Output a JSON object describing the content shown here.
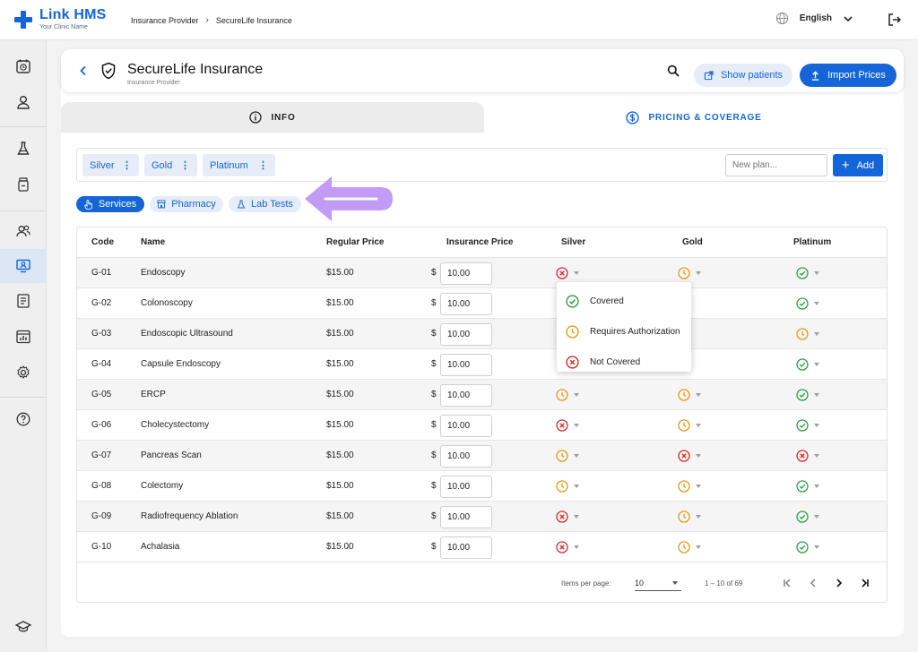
{
  "app": {
    "name": "Link HMS",
    "subtitle": "Your Clinic Name",
    "brand_color": "#1565d8"
  },
  "breadcrumb": [
    "Insurance Provider",
    "SecureLife Insurance"
  ],
  "topbar": {
    "language": "English"
  },
  "header": {
    "title": "SecureLife Insurance",
    "subtitle": "Insurance Provider",
    "show_patients": "Show patients",
    "import_prices": "Import Prices"
  },
  "tabs": [
    {
      "label": "INFO",
      "active": false
    },
    {
      "label": "PRICING & COVERAGE",
      "active": true
    }
  ],
  "plans": [
    {
      "label": "Silver"
    },
    {
      "label": "Gold"
    },
    {
      "label": "Platinum"
    }
  ],
  "new_plan_placeholder": "New plan...",
  "add_label": "Add",
  "categories": [
    {
      "label": "Services",
      "active": true
    },
    {
      "label": "Pharmacy",
      "active": false
    },
    {
      "label": "Lab Tests",
      "active": false
    }
  ],
  "table": {
    "headers": [
      "Code",
      "Name",
      "Regular Price",
      "Insurance Price",
      "Silver",
      "Gold",
      "Platinum"
    ],
    "currency_symbol": "$",
    "rows": [
      {
        "code": "G-01",
        "name": "Endoscopy",
        "regular": "$15.00",
        "insurance": "10.00",
        "silver": "not_covered",
        "gold": "requires_auth",
        "platinum": "covered"
      },
      {
        "code": "G-02",
        "name": "Colonoscopy",
        "regular": "$15.00",
        "insurance": "10.00",
        "silver": "",
        "gold": "",
        "platinum": "covered"
      },
      {
        "code": "G-03",
        "name": "Endoscopic Ultrasound",
        "regular": "$15.00",
        "insurance": "10.00",
        "silver": "",
        "gold": "",
        "platinum": "requires_auth"
      },
      {
        "code": "G-04",
        "name": "Capsule Endoscopy",
        "regular": "$15.00",
        "insurance": "10.00",
        "silver": "",
        "gold": "",
        "platinum": "covered"
      },
      {
        "code": "G-05",
        "name": "ERCP",
        "regular": "$15.00",
        "insurance": "10.00",
        "silver": "requires_auth",
        "gold": "requires_auth",
        "platinum": "covered"
      },
      {
        "code": "G-06",
        "name": "Cholecystectomy",
        "regular": "$15.00",
        "insurance": "10.00",
        "silver": "not_covered",
        "gold": "requires_auth",
        "platinum": "covered"
      },
      {
        "code": "G-07",
        "name": "Pancreas Scan",
        "regular": "$15.00",
        "insurance": "10.00",
        "silver": "requires_auth",
        "gold": "not_covered",
        "platinum": "not_covered"
      },
      {
        "code": "G-08",
        "name": "Colectomy",
        "regular": "$15.00",
        "insurance": "10.00",
        "silver": "requires_auth",
        "gold": "requires_auth",
        "platinum": "covered"
      },
      {
        "code": "G-09",
        "name": "Radiofrequency Ablation",
        "regular": "$15.00",
        "insurance": "10.00",
        "silver": "not_covered",
        "gold": "requires_auth",
        "platinum": "covered"
      },
      {
        "code": "G-10",
        "name": "Achalasia",
        "regular": "$15.00",
        "insurance": "10.00",
        "silver": "not_covered",
        "gold": "requires_auth",
        "platinum": "covered"
      }
    ]
  },
  "coverage_menu": [
    {
      "label": "Covered",
      "status": "covered"
    },
    {
      "label": "Requires Authorization",
      "status": "requires_auth"
    },
    {
      "label": "Not Covered",
      "status": "not_covered"
    }
  ],
  "status_colors": {
    "covered": "#2e9e44",
    "requires_auth": "#e39a17",
    "not_covered": "#d62b2b"
  },
  "pagination": {
    "items_per_page_label": "Items per page:",
    "items_per_page": "10",
    "range": "1 – 10 of 69"
  },
  "annotation": {
    "arrow_color": "#c39af5"
  }
}
